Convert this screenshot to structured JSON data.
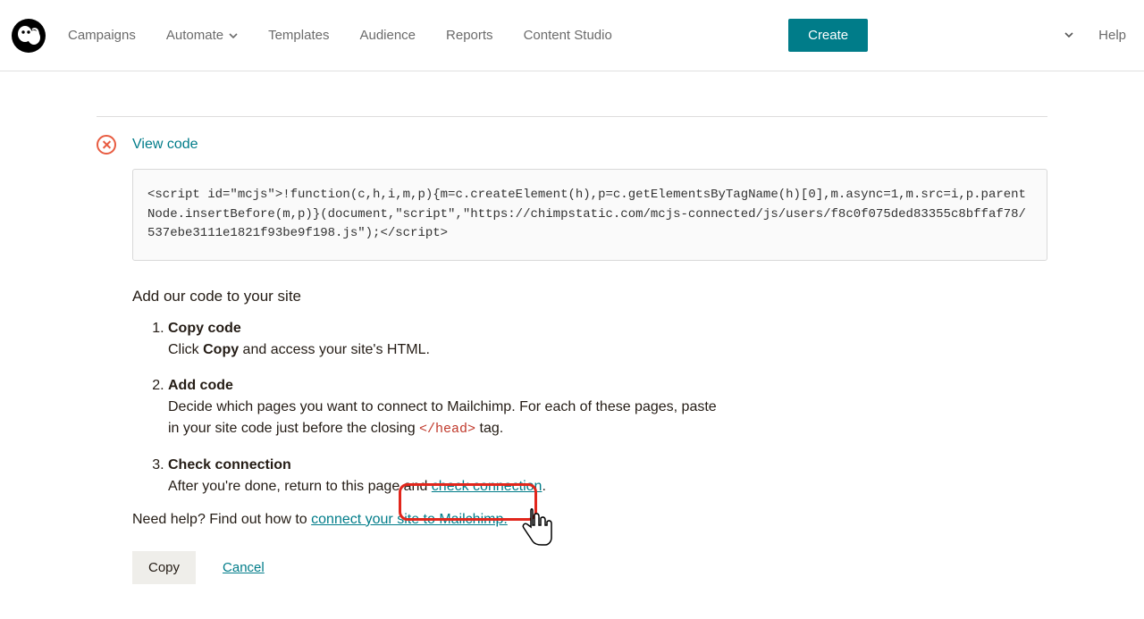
{
  "nav": {
    "campaigns": "Campaigns",
    "automate": "Automate",
    "templates": "Templates",
    "audience": "Audience",
    "reports": "Reports",
    "content_studio": "Content Studio"
  },
  "create_button": "Create",
  "help": "Help",
  "view_code": "View code",
  "code_snippet": "<script id=\"mcjs\">!function(c,h,i,m,p){m=c.createElement(h),p=c.getElementsByTagName(h)[0],m.async=1,m.src=i,p.parentNode.insertBefore(m,p)}(document,\"script\",\"https://chimpstatic.com/mcjs-connected/js/users/f8c0f075ded83355c8bffaf78/537ebe3111e1821f93be9f198.js\");</script>",
  "instructions_heading": "Add our code to your site",
  "steps": {
    "s1_title": "Copy code",
    "s1_pre": "Click ",
    "s1_bold": "Copy",
    "s1_post": " and access your site's HTML.",
    "s2_title": "Add code",
    "s2_body_pre": "Decide which pages you want to connect to Mailchimp. For each of these pages, paste in your site code just before the closing ",
    "s2_code": "</head>",
    "s2_body_post": " tag.",
    "s3_title": "Check connection",
    "s3_body_pre": "After you're done, return to this page and ",
    "s3_link": "check connection",
    "s3_body_post": "."
  },
  "help_line_pre": "Need help? Find out how to ",
  "help_line_link": "connect your site to Mailchimp.",
  "buttons": {
    "copy": "Copy",
    "cancel": "Cancel"
  }
}
